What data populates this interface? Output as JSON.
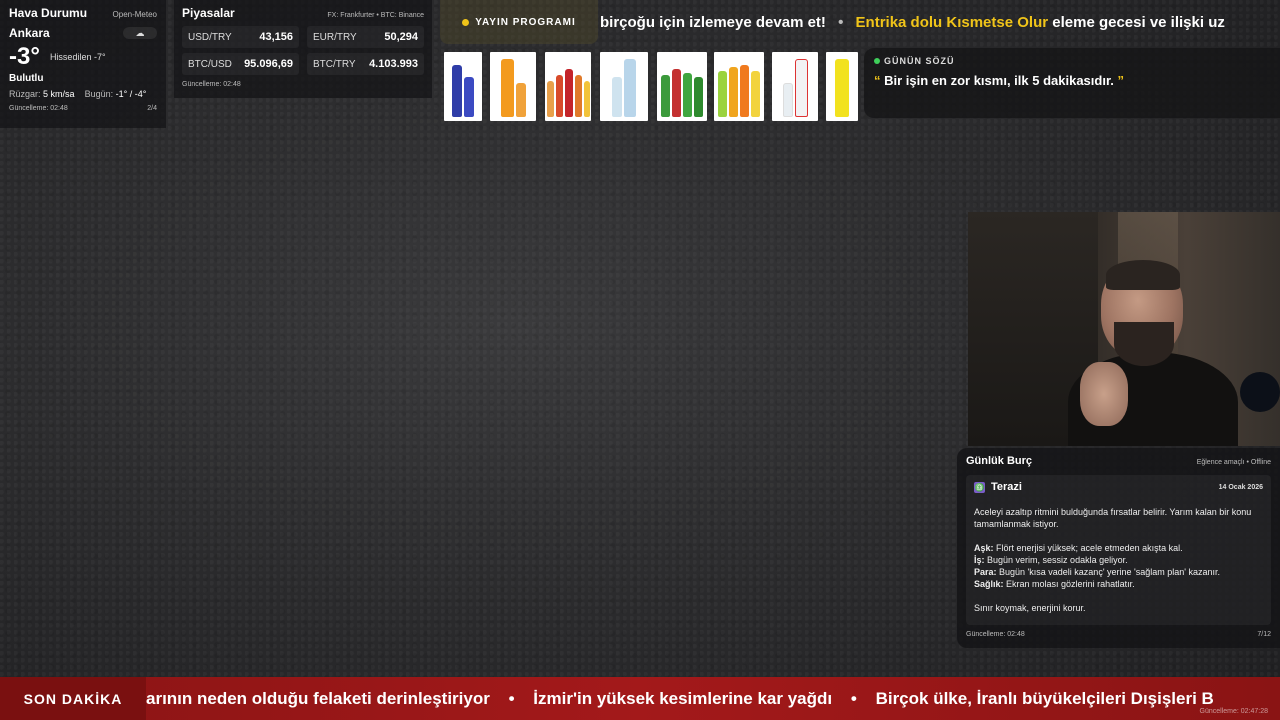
{
  "weather": {
    "title": "Hava Durumu",
    "source": "Open-Meteo",
    "city": "Ankara",
    "temperature": "-3°",
    "feels_like": "Hissedilen -7°",
    "description": "Bulutlu",
    "wind_label": "Rüzgar:",
    "wind_value": "5 km/sa",
    "today_label": "Bugün:",
    "today_value": "-1° / -4°",
    "updated": "Güncelleme: 02:48",
    "page": "2/4"
  },
  "markets": {
    "title": "Piyasalar",
    "source": "FX: Frankfurter • BTC: Binance",
    "items": [
      {
        "label": "USD/TRY",
        "value": "43,156"
      },
      {
        "label": "EUR/TRY",
        "value": "50,294"
      },
      {
        "label": "BTC/USD",
        "value": "95.096,69"
      },
      {
        "label": "BTC/TRY",
        "value": "4.103.993"
      }
    ],
    "updated": "Güncelleme: 02:48"
  },
  "schedule": {
    "label": "YAYIN PROGRAMI",
    "ticker_part1": "birçoğu için izlemeye devam et!",
    "separator": "•",
    "ticker_highlight": "Entrika dolu Kısmetse Olur",
    "ticker_part2": "eleme gecesi ve ilişki uz"
  },
  "quote": {
    "label": "GÜNÜN SÖZÜ",
    "open_mark": "“",
    "text": "Bir işin en zor kısmı, ilk 5 dakikasıdır.",
    "close_mark": "”"
  },
  "horoscope": {
    "title": "Günlük Burç",
    "meta": "Eğlence amaçlı • Offline",
    "sign_symbol": "♎",
    "sign": "Terazi",
    "date": "14 Ocak 2026",
    "intro": "Aceleyi azaltıp ritmini bulduğunda fırsatlar belirir. Yarım kalan bir konu tamamlanmak istiyor.",
    "love_label": "Aşk:",
    "love": "Flört enerjisi yüksek; acele etmeden akışta kal.",
    "work_label": "İş:",
    "work": "Bugün verim, sessiz odakla geliyor.",
    "money_label": "Para:",
    "money": "Bugün 'kısa vadeli kazanç' yerine 'sağlam plan' kazanır.",
    "health_label": "Sağlık:",
    "health": "Ekran molası gözlerini rahatlatır.",
    "closing": "Sınır koymak, enerjini korur.",
    "updated": "Güncelleme: 02:48",
    "page": "7/12"
  },
  "breaking": {
    "label": "SON DAKİKA",
    "item1": "arının neden olduğu felaketi derinleştiriyor",
    "separator": "•",
    "item2": "İzmir'in yüksek kesimlerine kar yağdı",
    "item3": "Birçok ülke, İranlı büyükelçileri Dışişleri B",
    "updated": "Güncelleme: 02:47:28"
  },
  "colors": {
    "accent_yellow": "#f0c419",
    "live_green": "#3ecf5a",
    "breaking_red": "#a3191a"
  }
}
